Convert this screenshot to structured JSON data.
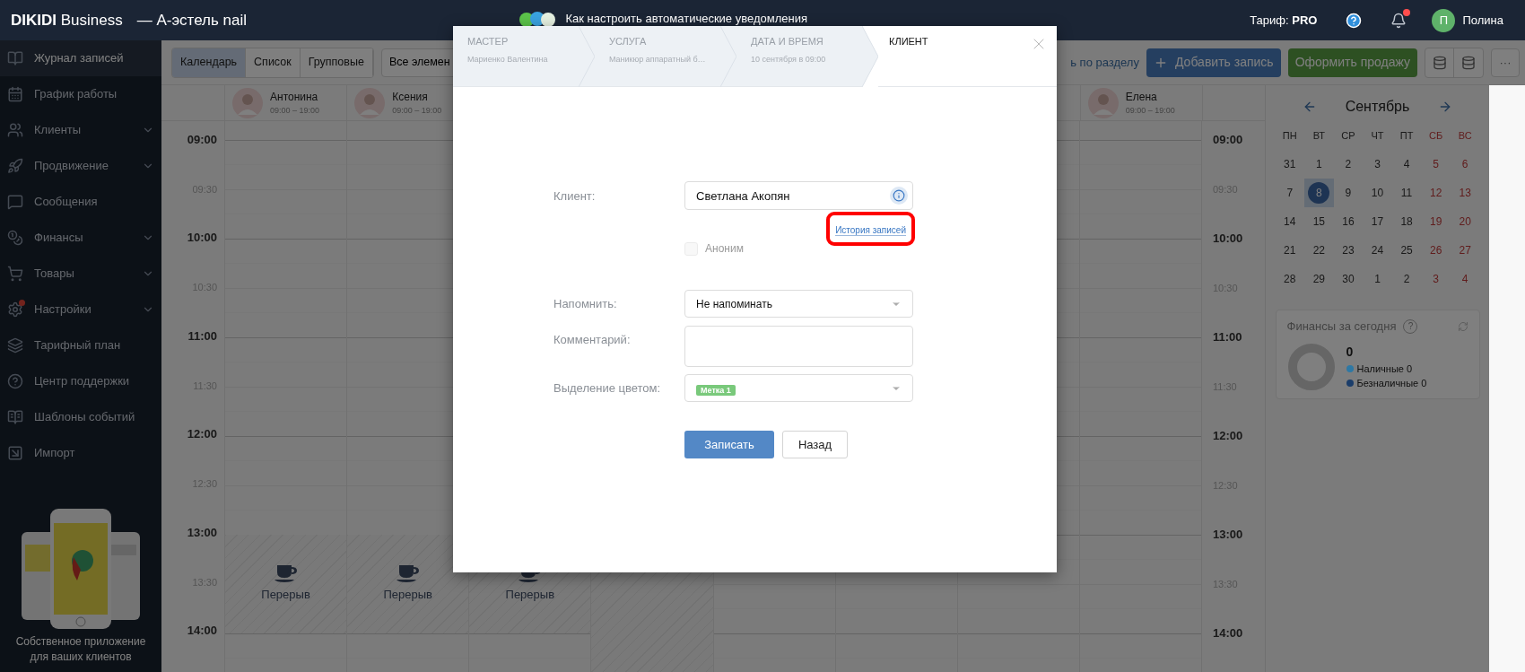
{
  "header": {
    "brand_bold": "DIKIDI",
    "brand_rest": "Business",
    "salon": "— А-эстель nail",
    "tip": "Как настроить автоматические уведомления",
    "tariff_label": "Тариф:",
    "tariff_value": "PRO",
    "notifications_unread": true,
    "user_initial": "П",
    "user_name": "Полина"
  },
  "sidebar": {
    "items": [
      {
        "label": "Журнал записей",
        "selected": true,
        "expandable": false,
        "alert": false
      },
      {
        "label": "График работы",
        "selected": false,
        "expandable": false,
        "alert": false
      },
      {
        "label": "Клиенты",
        "selected": false,
        "expandable": true,
        "alert": false
      },
      {
        "label": "Продвижение",
        "selected": false,
        "expandable": true,
        "alert": false
      },
      {
        "label": "Сообщения",
        "selected": false,
        "expandable": false,
        "alert": false
      },
      {
        "label": "Финансы",
        "selected": false,
        "expandable": true,
        "alert": false
      },
      {
        "label": "Товары",
        "selected": false,
        "expandable": true,
        "alert": false
      },
      {
        "label": "Настройки",
        "selected": false,
        "expandable": true,
        "alert": true
      },
      {
        "label": "Тарифный план",
        "selected": false,
        "expandable": false,
        "alert": false
      },
      {
        "label": "Центр поддержки",
        "selected": false,
        "expandable": false,
        "alert": false
      },
      {
        "label": "Шаблоны событий",
        "selected": false,
        "expandable": false,
        "alert": false
      },
      {
        "label": "Импорт",
        "selected": false,
        "expandable": false,
        "alert": false
      }
    ],
    "promo": "Собственное приложение для ваших клиентов"
  },
  "toolbar": {
    "views": [
      {
        "label": "Календарь",
        "selected": true
      },
      {
        "label": "Список",
        "selected": false
      },
      {
        "label": "Групповые",
        "selected": false
      }
    ],
    "filter": "Все элемен",
    "section_link": "ь по разделу",
    "add_button": "Добавить запись",
    "sale_button": "Оформить продажу",
    "more_button": "···"
  },
  "calendar": {
    "columns": [
      {
        "staff": {
          "name": "Антонина",
          "hours": "09:00 – 19:00"
        },
        "break": {
          "kind": "break",
          "label": "Перерыв"
        }
      },
      {
        "staff": {
          "name": "Ксения",
          "hours": "09:00 – 19:00"
        },
        "break": {
          "kind": "break",
          "label": "Перерыв"
        }
      },
      {
        "break": {
          "kind": "break",
          "label": "Перерыв"
        }
      },
      {
        "break": {
          "kind": "off"
        }
      },
      {},
      {},
      {},
      {
        "staff": {
          "name": "Елена",
          "hours": "09:00 – 19:00"
        }
      }
    ],
    "time_rows": [
      {
        "left": "09:00",
        "right": "09:00",
        "kind": "hour"
      },
      {
        "left": "09:30",
        "right": "09:30",
        "kind": "half"
      },
      {
        "left": "10:00",
        "right": "10:00",
        "kind": "hour"
      },
      {
        "left": "10:30",
        "right": "10:30",
        "kind": "half"
      },
      {
        "left": "11:00",
        "right": "11:00",
        "kind": "hour"
      },
      {
        "left": "11:30",
        "right": "11:30",
        "kind": "half"
      },
      {
        "left": "12:00",
        "right": "12:00",
        "kind": "hour"
      },
      {
        "left": "12:30",
        "right": "12:30",
        "kind": "half"
      },
      {
        "left": "13:00",
        "right": "13:00",
        "kind": "hour"
      },
      {
        "left": "13:30",
        "right": "13:30",
        "kind": "half"
      },
      {
        "left": "14:00",
        "right": "14:00",
        "kind": "hour"
      }
    ]
  },
  "mini_calendar": {
    "month": "Сентябрь",
    "weekdays": [
      {
        "label": "ПН",
        "weekend": false
      },
      {
        "label": "ВТ",
        "weekend": false
      },
      {
        "label": "СР",
        "weekend": false
      },
      {
        "label": "ЧТ",
        "weekend": false
      },
      {
        "label": "ПТ",
        "weekend": false
      },
      {
        "label": "СБ",
        "weekend": true
      },
      {
        "label": "ВС",
        "weekend": true
      }
    ],
    "days": [
      {
        "label": "31",
        "selected": false
      },
      {
        "label": "1",
        "selected": false
      },
      {
        "label": "2",
        "selected": false
      },
      {
        "label": "3",
        "selected": false
      },
      {
        "label": "4",
        "selected": false
      },
      {
        "label": "5",
        "selected": false
      },
      {
        "label": "6",
        "selected": false
      },
      {
        "label": "7",
        "selected": false
      },
      {
        "label": "8",
        "selected": true
      },
      {
        "label": "9",
        "selected": false
      },
      {
        "label": "10",
        "selected": false
      },
      {
        "label": "11",
        "selected": false
      },
      {
        "label": "12",
        "selected": false
      },
      {
        "label": "13",
        "selected": false
      },
      {
        "label": "14",
        "selected": false
      },
      {
        "label": "15",
        "selected": false
      },
      {
        "label": "16",
        "selected": false
      },
      {
        "label": "17",
        "selected": false
      },
      {
        "label": "18",
        "selected": false
      },
      {
        "label": "19",
        "selected": false
      },
      {
        "label": "20",
        "selected": false
      },
      {
        "label": "21",
        "selected": false
      },
      {
        "label": "22",
        "selected": false
      },
      {
        "label": "23",
        "selected": false
      },
      {
        "label": "24",
        "selected": false
      },
      {
        "label": "25",
        "selected": false
      },
      {
        "label": "26",
        "selected": false
      },
      {
        "label": "27",
        "selected": false
      },
      {
        "label": "28",
        "selected": false
      },
      {
        "label": "29",
        "selected": false
      },
      {
        "label": "30",
        "selected": false
      },
      {
        "label": "1",
        "selected": false
      },
      {
        "label": "2",
        "selected": false
      },
      {
        "label": "3",
        "selected": false
      },
      {
        "label": "4",
        "selected": false
      }
    ]
  },
  "finance": {
    "title": "Финансы за сегодня",
    "help": "?",
    "total": "0",
    "legend": [
      {
        "label": "Наличные",
        "value": "0",
        "color": "#2e78a4"
      },
      {
        "label": "Безналичные",
        "value": "0",
        "color": "#1b3d6a"
      }
    ]
  },
  "modal": {
    "steps": [
      {
        "title": "МАСТЕР",
        "value": "Мариенко Валентина",
        "selected": false
      },
      {
        "title": "УСЛУГА",
        "value": "Маникюр аппаратный б…",
        "selected": false
      },
      {
        "title": "ДАТА И ВРЕМЯ",
        "value": "10 сентября в 09:00",
        "selected": false
      },
      {
        "title": "КЛИЕНТ",
        "selected": true
      }
    ],
    "client_label": "Клиент:",
    "client_value": "Светлана Акопян",
    "history_link": {
      "label": "История записей",
      "highlighted": true
    },
    "anonymous": {
      "label": "Аноним",
      "checked": false,
      "disabled": true
    },
    "remind_label": "Напомнить:",
    "remind_value": "Не напоминать",
    "comment_label": "Комментарий:",
    "color_label": "Выделение цветом:",
    "color_tag": {
      "label": "Метка 1",
      "color": "#79c97b"
    },
    "submit": "Записать",
    "back": "Назад"
  }
}
